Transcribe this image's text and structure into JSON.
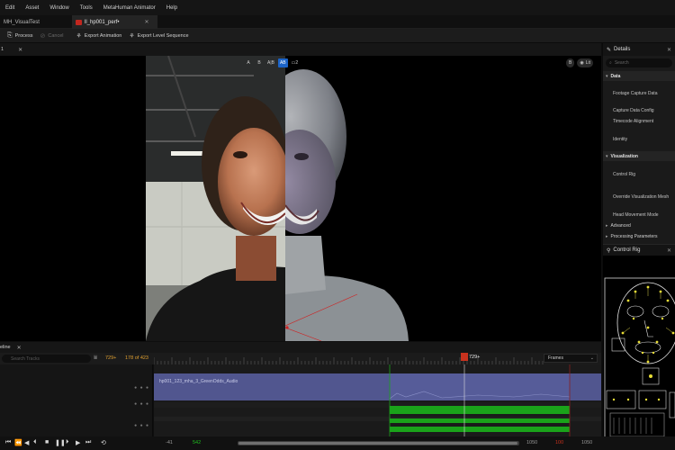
{
  "menu": [
    "Edit",
    "Asset",
    "Window",
    "Tools",
    "MetaHuman Animator",
    "Help"
  ],
  "tabs": [
    {
      "label": "MH_VisualTest",
      "active": false
    },
    {
      "label": "ll_hp001_perf•",
      "active": true
    }
  ],
  "toolbar": {
    "process": "Process",
    "cancel": "Cancel",
    "export_animation": "Export Animation",
    "export_level_sequence": "Export Level Sequence"
  },
  "viewport": {
    "panel_number": "1",
    "view_buttons": [
      "A",
      "B",
      "A|B",
      "AB"
    ],
    "frame_indicator": "2",
    "right_pills": [
      "B",
      "Lit"
    ]
  },
  "details": {
    "title": "Details",
    "search_placeholder": "Search",
    "sections": {
      "data": "Data",
      "visualization": "Visualization",
      "advanced": "Advanced",
      "processing": "Processing Parameters"
    },
    "data_props": [
      "Footage Capture Data",
      "Capture Data Config",
      "Timecode Alignment",
      "Identity"
    ],
    "visual_props": [
      "Control Rig",
      "Override Visualization Mesh",
      "Head Movement Mode"
    ]
  },
  "control_rig_panel": {
    "title": "Control Rig"
  },
  "sequencer": {
    "tab_name": "eline",
    "search_placeholder": "Search Tracks",
    "current_frame": "729+",
    "frame_count": "178 of 423",
    "playhead": "729+",
    "display_mode": "Frames",
    "track_label": "hp001_123_mha_3_GreenOdds_Audio",
    "start_frame": "542",
    "end_frame": "1050",
    "left_outer": "-41",
    "right_marker": "100",
    "right_outer": "1050",
    "right_playhead": "1050"
  },
  "colors": {
    "accent_blue": "#1c64c8",
    "audio_track": "#51568f",
    "green_keys": "#1aa31a",
    "playhead_red": "#c8321e"
  }
}
